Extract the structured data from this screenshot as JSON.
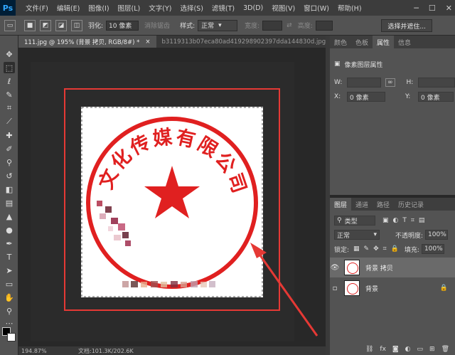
{
  "app": {
    "logo": "Ps"
  },
  "menu": [
    "文件(F)",
    "编辑(E)",
    "图像(I)",
    "图层(L)",
    "文字(Y)",
    "选择(S)",
    "滤镜(T)",
    "3D(D)",
    "视图(V)",
    "窗口(W)",
    "帮助(H)"
  ],
  "options": {
    "feather_label": "羽化:",
    "feather_value": "10 像素",
    "antialias_label": "消除锯齿",
    "style_label": "样式:",
    "style_value": "正常",
    "width_label": "宽度:",
    "height_label": "高度:",
    "select_mask_button": "选择并遮住..."
  },
  "tabs": [
    {
      "label": "111.jpg @ 195% (背景 拷贝, RGB/8#) *",
      "active": true
    },
    {
      "label": "b3119313b07eca80ad419298902397dda144830d.jpg",
      "active": false
    }
  ],
  "statusbar": {
    "zoom": "194.87%",
    "doc": "文档:101.3K/202.6K"
  },
  "properties": {
    "tabs": [
      "颜色",
      "色板",
      "属性",
      "信息"
    ],
    "active_tab": "属性",
    "title": "像素图层属性",
    "w_label": "W:",
    "h_label": "H:",
    "x_label": "X:",
    "x_value": "0 像素",
    "y_label": "Y:",
    "y_value": "0 像素"
  },
  "layers": {
    "tabs": [
      "图层",
      "通道",
      "路径",
      "历史记录"
    ],
    "filter_type": "类型",
    "blend_mode": "正常",
    "opacity_label": "不透明度:",
    "opacity_value": "100%",
    "lock_label": "锁定:",
    "fill_label": "填充:",
    "fill_value": "100%",
    "items": [
      {
        "name": "背景 拷贝",
        "visible": true,
        "selected": true
      },
      {
        "name": "背景",
        "visible": false,
        "selected": false,
        "locked": true
      }
    ]
  },
  "stamp": {
    "text": "文化传媒有限公司",
    "color": "#e02020"
  }
}
